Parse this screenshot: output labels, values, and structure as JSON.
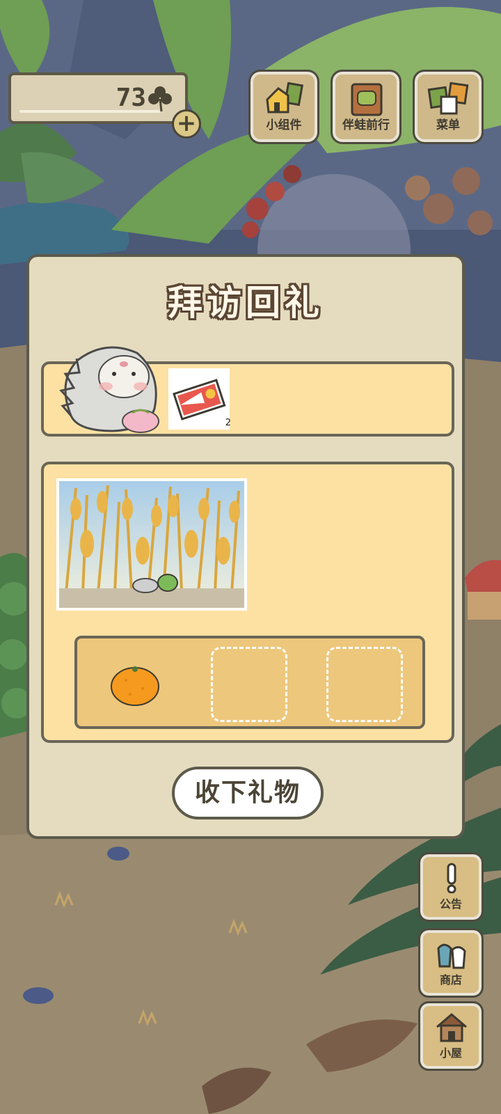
{
  "currency": {
    "clover_count": "73",
    "clover_icon": "clover-icon",
    "add_icon": "plus-icon"
  },
  "top_buttons": [
    {
      "label": "小组件",
      "icon": "widget-icon"
    },
    {
      "label": "伴蛙前行",
      "icon": "journey-book-icon"
    },
    {
      "label": "菜单",
      "icon": "menu-cards-icon"
    }
  ],
  "side_buttons": [
    {
      "label": "公告",
      "icon": "exclamation-icon"
    },
    {
      "label": "商店",
      "icon": "shop-bags-icon"
    },
    {
      "label": "小屋",
      "icon": "house-icon"
    }
  ],
  "dialog": {
    "title": "拜访回礼",
    "visitor": {
      "icon": "hedgehog-icon"
    },
    "gift": {
      "icon": "ticket-icon",
      "quantity": "2"
    },
    "photo": {
      "icon": "wheat-field-photo"
    },
    "items": [
      {
        "icon": "orange-icon"
      },
      {
        "icon": "empty-slot"
      },
      {
        "icon": "empty-slot"
      }
    ],
    "accept_label": "收下礼物"
  },
  "colors": {
    "dialog_bg": "#e5dcbf",
    "panel_bg": "#fde1a3",
    "tray_bg": "#edc77c",
    "border": "#5c5a4c"
  }
}
